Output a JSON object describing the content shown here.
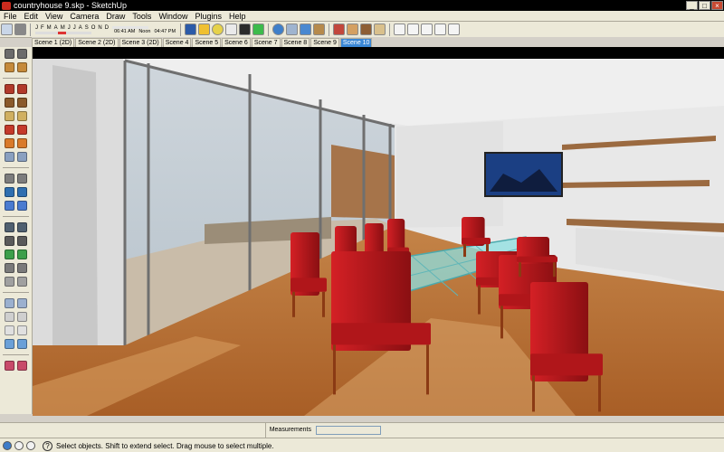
{
  "window": {
    "title": "countryhouse 9.skp - SketchUp",
    "min": "_",
    "max": "□",
    "close": "×"
  },
  "menu": [
    "File",
    "Edit",
    "View",
    "Camera",
    "Draw",
    "Tools",
    "Window",
    "Plugins",
    "Help"
  ],
  "shadows": {
    "months": [
      "J",
      "F",
      "M",
      "A",
      "M",
      "J",
      "J",
      "A",
      "S",
      "O",
      "N",
      "D"
    ],
    "time_start": "06:41 AM",
    "time_mid": "Noon",
    "time_end": "04:47 PM"
  },
  "toolbar_icons": [
    "select-icon",
    "components-icon",
    "paint-icon",
    "eraser-icon",
    "orbit-icon",
    "zoom-extents-icon",
    "hand-icon",
    "walk-icon",
    "shadow-icon",
    "fog-icon",
    "layers-icon",
    "section-icon",
    "iso-view-icon",
    "top-view-icon",
    "front-view-icon",
    "right-view-icon",
    "back-view-icon",
    "left-view-icon"
  ],
  "scenes": [
    "Scene 1 (2D)",
    "Scene 2 (2D)",
    "Scene 3 (2D)",
    "Scene 4",
    "Scene 5",
    "Scene 6",
    "Scene 7",
    "Scene 8",
    "Scene 9",
    "Scene 10"
  ],
  "active_scene": "Scene 10",
  "left_tools": [
    [
      "select-icon",
      "make-component-icon"
    ],
    [
      "paint-bucket-icon",
      "eraser-icon"
    ],
    [
      "rectangle-icon",
      "line-icon"
    ],
    [
      "circle-icon",
      "arc-icon"
    ],
    [
      "polygon-icon",
      "freehand-icon"
    ],
    [
      "move-icon",
      "push-pull-icon"
    ],
    [
      "rotate-icon",
      "follow-me-icon"
    ],
    [
      "scale-icon",
      "offset-icon"
    ],
    [
      "tape-measure-icon",
      "dimension-icon"
    ],
    [
      "protractor-icon",
      "text-icon"
    ],
    [
      "axes-icon",
      "3d-text-icon"
    ],
    [
      "orbit-icon",
      "pan-icon"
    ],
    [
      "zoom-icon",
      "zoom-window-icon"
    ],
    [
      "previous-view-icon",
      "zoom-extents-icon"
    ],
    [
      "position-camera-icon",
      "look-around-icon"
    ],
    [
      "walk-icon",
      "section-plane-icon"
    ],
    [
      "iso-view-icon",
      "top-view-icon"
    ],
    [
      "front-view-icon",
      "right-view-icon"
    ],
    [
      "back-view-icon",
      "left-view-icon"
    ],
    [
      "xray-icon",
      "wireframe-icon"
    ],
    [
      "get-models-icon",
      "share-model-icon"
    ]
  ],
  "colors": {
    "chair": "#b0161a",
    "floor": "#c07a3a",
    "glass_table": "#7fd4d6",
    "wall": "#e6e6e6",
    "active_tab": "#3a87d6"
  },
  "measurements": {
    "label": "Measurements",
    "value": ""
  },
  "status": {
    "text": "Select objects. Shift to extend select. Drag mouse to select multiple."
  }
}
